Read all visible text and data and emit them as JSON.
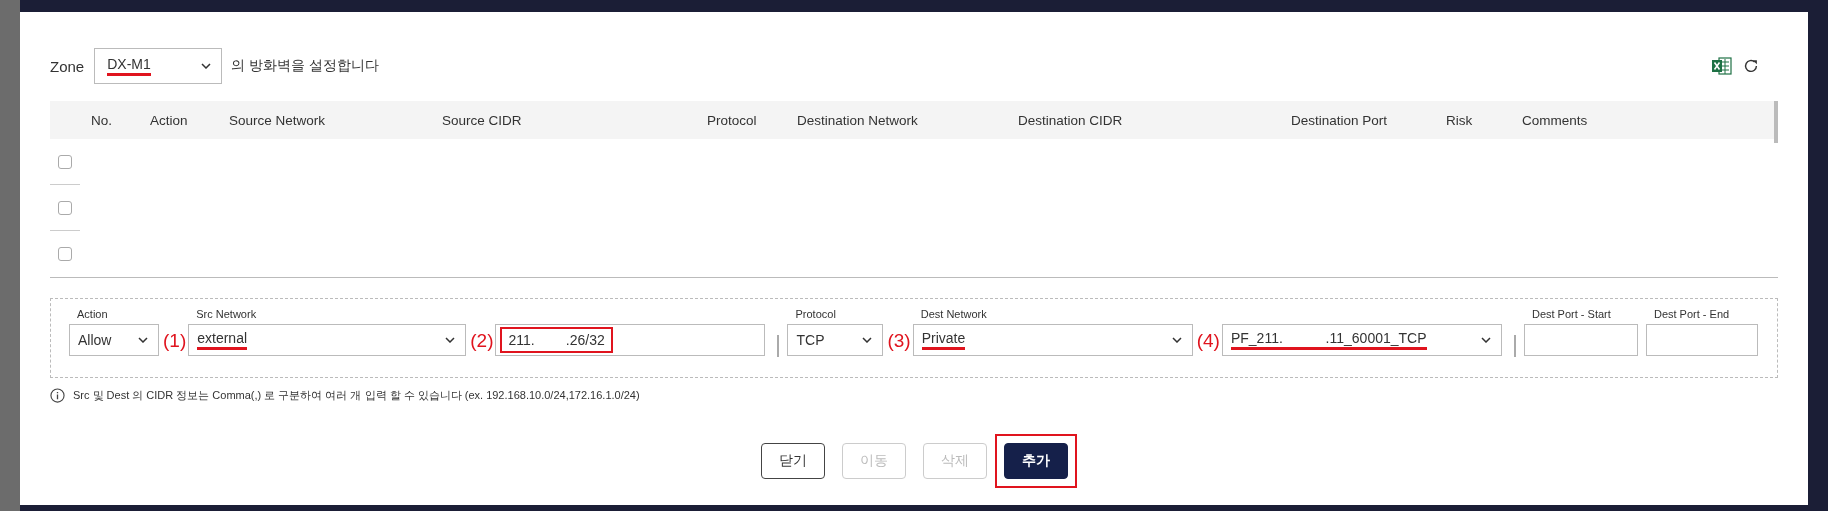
{
  "zone": {
    "label": "Zone",
    "value": "DX-M1",
    "underlined": true,
    "suffix": "의 방화벽을 설정합니다"
  },
  "table": {
    "columns": [
      "No.",
      "Action",
      "Source Network",
      "Source CIDR",
      "Protocol",
      "Destination Network",
      "Destination CIDR",
      "Destination Port",
      "Risk",
      "Comments"
    ],
    "rows": [
      {
        "checked": false
      },
      {
        "checked": false
      },
      {
        "checked": false
      }
    ]
  },
  "form": {
    "fields": [
      {
        "kind": "select",
        "label": "Action",
        "value": "Allow"
      },
      {
        "kind": "select",
        "label": "Src Network",
        "value": "external",
        "annotation": {
          "number": "(1)",
          "underlined": true,
          "boxed": false
        }
      },
      {
        "kind": "input",
        "value": "211.        .26/32",
        "annotation": {
          "number": "(2)",
          "underlined": false,
          "boxed": true
        }
      },
      {
        "kind": "divider"
      },
      {
        "kind": "select",
        "label": "Protocol",
        "value": "TCP"
      },
      {
        "kind": "select",
        "label": "Dest Network",
        "value": "Private",
        "annotation": {
          "number": "(3)",
          "underlined": true,
          "boxed": false
        }
      },
      {
        "kind": "select",
        "value": "PF_211.           .11_60001_TCP",
        "annotation": {
          "number": "(4)",
          "underlined": true,
          "boxed": false
        }
      },
      {
        "kind": "divider"
      },
      {
        "kind": "input",
        "label": "Dest Port - Start"
      },
      {
        "kind": "input",
        "label": "Dest Port - End"
      }
    ],
    "info": "Src 및 Dest 의 CIDR 정보는 Comma(,) 로 구분하여 여러 개 입력 할 수 있습니다 (ex. 192.168.10.0/24,172.16.1.0/24)"
  },
  "buttons": [
    {
      "label": "닫기",
      "kind": "outline",
      "disabled": false,
      "boxed": false
    },
    {
      "label": "이동",
      "kind": "outline",
      "disabled": true,
      "boxed": false
    },
    {
      "label": "삭제",
      "kind": "outline",
      "disabled": true,
      "boxed": false
    },
    {
      "label": "추가",
      "kind": "primary",
      "disabled": false,
      "boxed": true
    }
  ]
}
